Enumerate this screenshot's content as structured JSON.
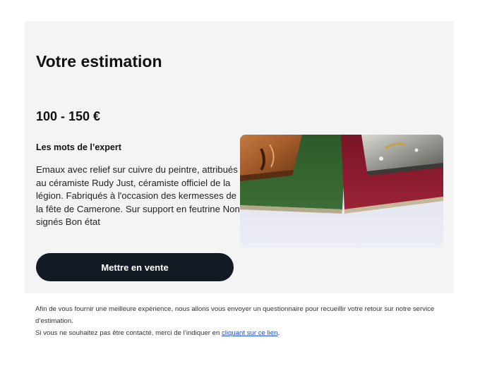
{
  "estimation": {
    "title": "Votre estimation",
    "price": "100 - 150 €"
  },
  "expert": {
    "heading": "Les mots de l’expert",
    "text": "Emaux avec relief sur cuivre du peintre, attribués au céramiste Rudy Just, céramiste officiel de la légion. Fabriqués à l'occasion des kermesses de la fête de Camerone. Sur support en feutrine Non signés Bon état"
  },
  "actions": {
    "sell_label": "Mettre en vente"
  },
  "footer": {
    "line1": "Afin de vous fournir une meilleure expérience, nous allons vous envoyer un questionnaire pour recueillir votre retour sur notre service d’estimation.",
    "line2_prefix": "Si vous ne souhaitez pas être contacté, merci de l’indiquer en ",
    "link_label": "cliquant sur ce lien",
    "line2_suffix": "."
  },
  "colors": {
    "card_background": "#f4f4f4",
    "button_background": "#121a24",
    "link": "#1a4fd6"
  }
}
